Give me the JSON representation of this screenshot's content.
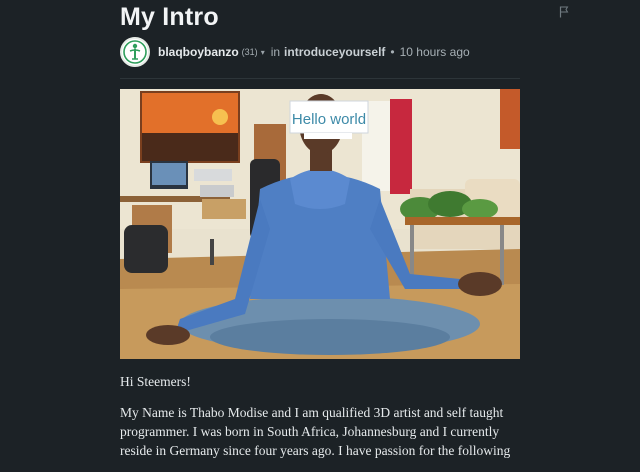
{
  "post": {
    "title": "My Intro",
    "author": "blaqboybanzo",
    "reputation": "(31)",
    "in_label": "in",
    "community": "introduceyourself",
    "separator": "•",
    "time": "10 hours ago"
  },
  "image": {
    "sign_text": "Hello world"
  },
  "body": {
    "greeting": "Hi Steemers!",
    "paragraph": "My Name is Thabo Modise and I am qualified 3D artist and self taught programmer. I was born in South Africa, Johannesburg and I currently reside in Germany since four years ago. I have passion for the following"
  },
  "icons": {
    "flag": "flag-icon",
    "caret": "chevron-down-icon",
    "avatar": "avatar-logo"
  },
  "colors": {
    "background": "#1c2226",
    "text": "#e8ecee",
    "muted": "#a7b0b5",
    "avatar_green": "#2e9e5b"
  }
}
